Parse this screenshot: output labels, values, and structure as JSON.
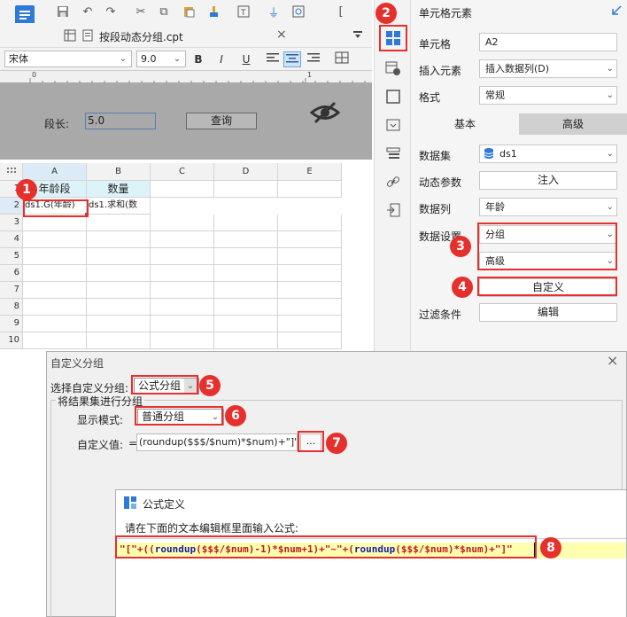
{
  "toolbar": {
    "icons": [
      "save-icon",
      "undo-icon",
      "redo-icon",
      "cut-icon",
      "copy-icon",
      "paste-icon",
      "format-brush-icon",
      "text-icon",
      "plug-icon",
      "search-icon",
      "brace-icon"
    ]
  },
  "file_tab": {
    "name": "按段动态分组.cpt",
    "close": "×"
  },
  "format_bar": {
    "font": "宋体",
    "size": "9.0",
    "bold": "B",
    "italic": "I",
    "underline": "U"
  },
  "ruler": {
    "mark_0": "0",
    "mark_1": "1"
  },
  "param_panel": {
    "label": "段长:",
    "value": "5.0",
    "query_button": "查询"
  },
  "sheet": {
    "columns": [
      "A",
      "B",
      "C",
      "D",
      "E"
    ],
    "rows": [
      "1",
      "2",
      "3",
      "4",
      "5",
      "6",
      "7",
      "8",
      "9",
      "10"
    ],
    "cells": {
      "A1": "年龄段",
      "B1": "数量",
      "A2": "ds1.G(年龄)",
      "B2": "ds1.求和(数"
    }
  },
  "right_panel": {
    "title": "单元格元素",
    "cell_label": "单元格",
    "cell_value": "A2",
    "insert_label": "插入元素",
    "insert_value": "插入数据列(D)",
    "format_label": "格式",
    "format_value": "常规",
    "tab_basic": "基本",
    "tab_advanced": "高级",
    "dataset_label": "数据集",
    "dataset_value": "ds1",
    "dynamic_label": "动态参数",
    "dynamic_button": "注入",
    "column_label": "数据列",
    "column_value": "年龄",
    "setting_label": "数据设置",
    "setting_group": "分组",
    "setting_adv": "高级",
    "custom_button": "自定义",
    "filter_label": "过滤条件",
    "filter_button": "编辑"
  },
  "custom_group_dialog": {
    "title": "自定义分组",
    "close": "×",
    "select_label": "选择自定义分组:",
    "select_value": "公式分组",
    "section_title": "将结果集进行分组",
    "display_label": "显示模式:",
    "display_value": "普通分组",
    "custom_label": "自定义值:",
    "custom_prefix": "=",
    "custom_value": "(roundup($$$/$num)*$num)+\"]\"",
    "ellipsis": "..."
  },
  "formula_dialog": {
    "title": "公式定义",
    "instruction": "请在下面的文本编辑框里面输入公式:",
    "formula_parts": [
      {
        "t": "\"[\"+((",
        "c": "#c41a16"
      },
      {
        "t": "roundup",
        "c": "#1a1aa6"
      },
      {
        "t": "($$$/$num)-1)*$num+1)+\"~\"+(",
        "c": "#c41a16"
      },
      {
        "t": "roundup",
        "c": "#1a1aa6"
      },
      {
        "t": "($$$/$num)*$num)+\"]\"",
        "c": "#c41a16"
      }
    ]
  },
  "markers": [
    "1",
    "2",
    "3",
    "4",
    "5",
    "6",
    "7",
    "8"
  ],
  "colors": {
    "accent": "#e5302d",
    "blue": "#2f7ad6",
    "param_bg": "#a9a9a9",
    "tab_bg": "#d0d0d0"
  }
}
